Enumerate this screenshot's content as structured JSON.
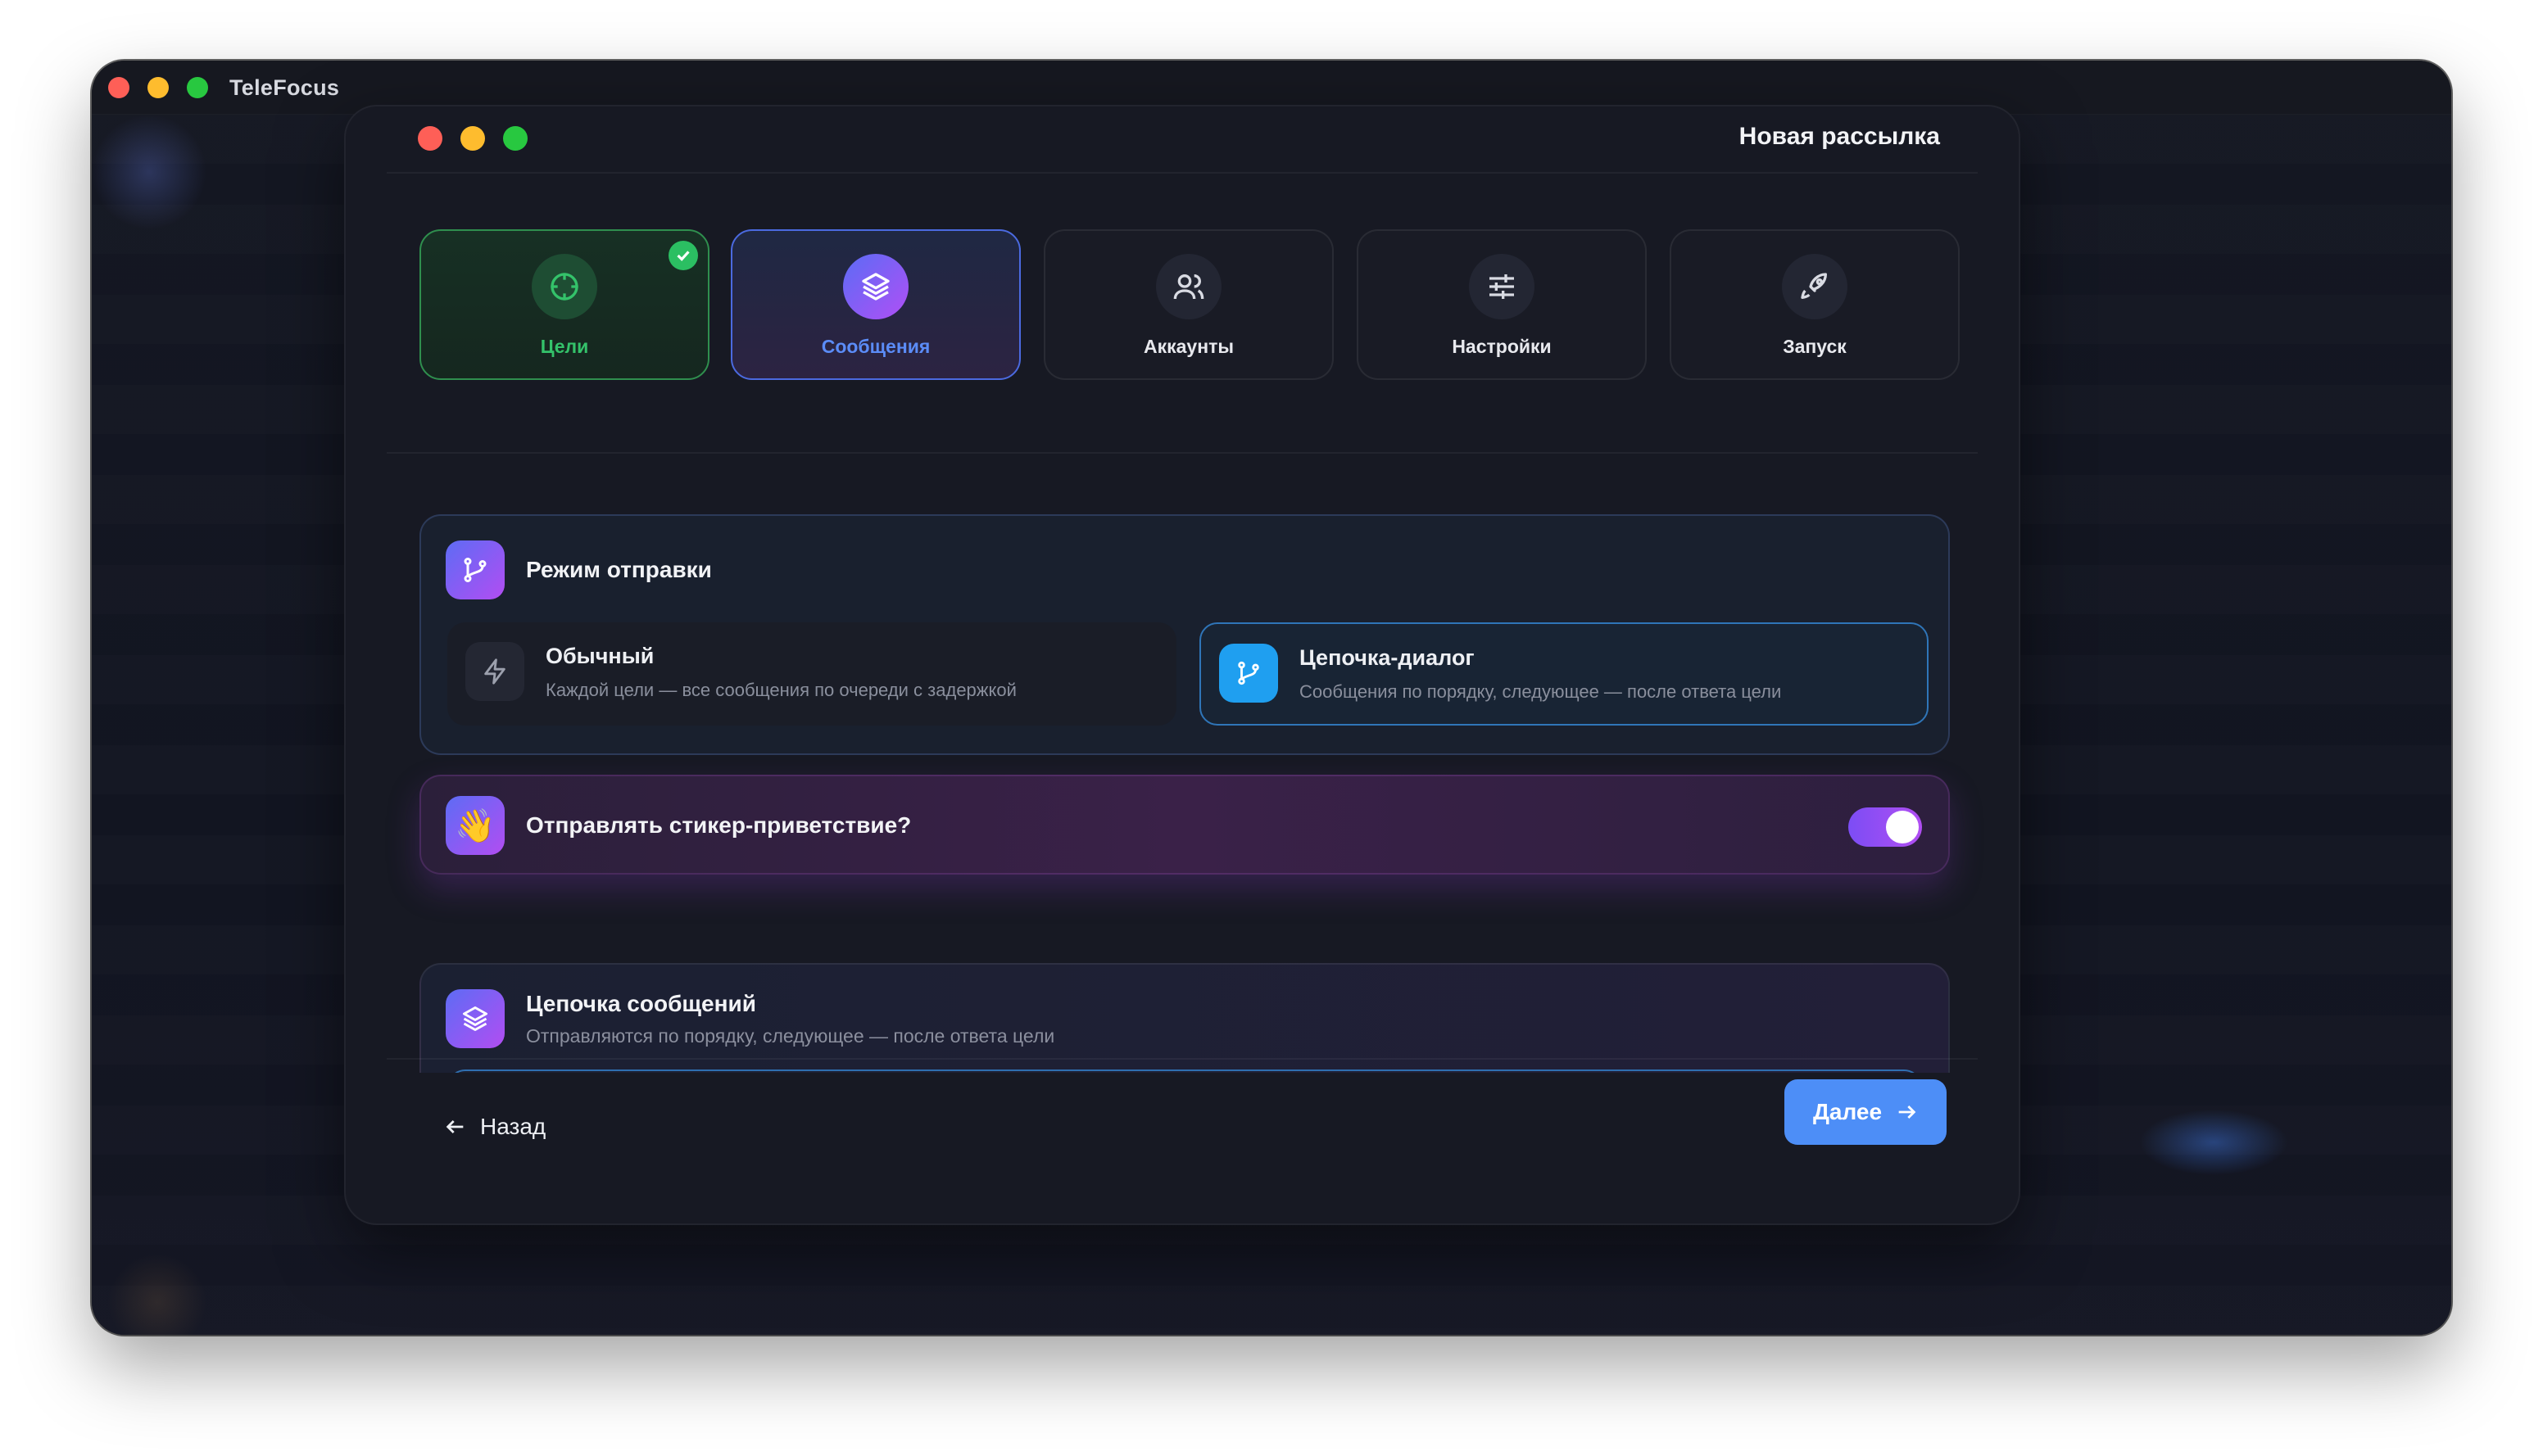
{
  "app": {
    "title": "TeleFocus"
  },
  "dialog": {
    "title": "Новая рассылка"
  },
  "steps": [
    {
      "label": "Цели",
      "icon": "target-icon",
      "state": "done"
    },
    {
      "label": "Сообщения",
      "icon": "layers-icon",
      "state": "active"
    },
    {
      "label": "Аккаунты",
      "icon": "users-icon",
      "state": "pending"
    },
    {
      "label": "Настройки",
      "icon": "sliders-icon",
      "state": "pending"
    },
    {
      "label": "Запуск",
      "icon": "rocket-icon",
      "state": "pending"
    }
  ],
  "send_mode": {
    "title": "Режим отправки",
    "options": [
      {
        "title": "Обычный",
        "description": "Каждой цели — все сообщения по очереди с задержкой",
        "selected": false
      },
      {
        "title": "Цепочка-диалог",
        "description": "Сообщения по порядку, следующее — после ответа цели",
        "selected": true
      }
    ]
  },
  "sticker": {
    "title": "Отправлять стикер-приветствие?",
    "enabled": true,
    "emoji": "👋"
  },
  "message_chain": {
    "title": "Цепочка сообщений",
    "subtitle": "Отправляются по порядку, следующее — после ответа цели"
  },
  "footer": {
    "back_label": "Назад",
    "next_label": "Далее"
  },
  "colors": {
    "accent": "#4d8ef7",
    "success": "#2bbf62",
    "purple": "#b04ff5"
  }
}
